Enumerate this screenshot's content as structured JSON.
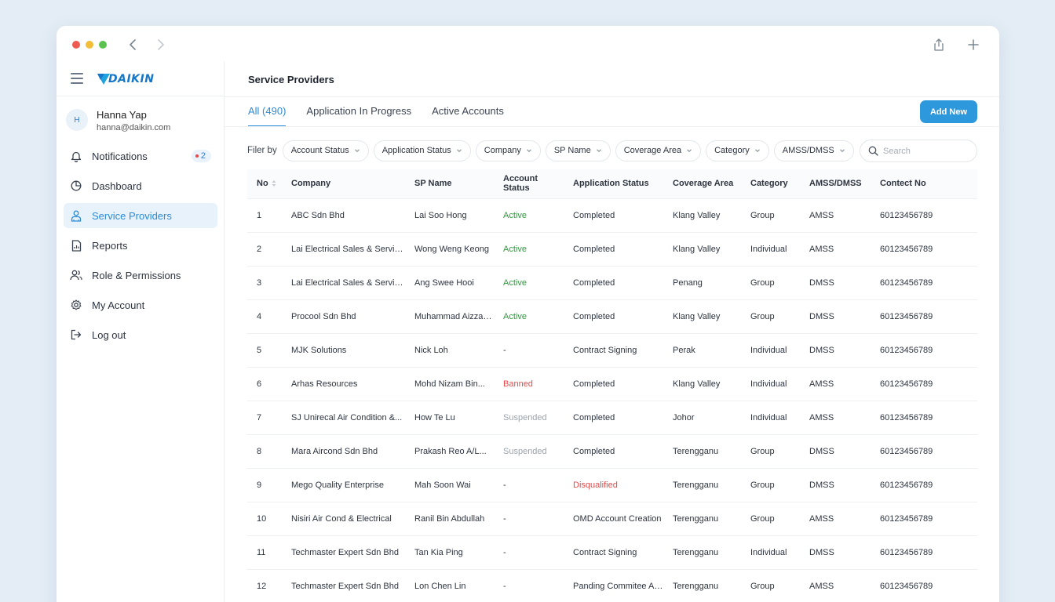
{
  "brand": {
    "name": "DAIKIN",
    "color": "#1677c8"
  },
  "user": {
    "initial": "H",
    "name": "Hanna Yap",
    "email": "hanna@daikin.com"
  },
  "menu": [
    {
      "label": "Notifications",
      "icon": "bell-icon",
      "badge": "2"
    },
    {
      "label": "Dashboard",
      "icon": "dashboard-icon"
    },
    {
      "label": "Service Providers",
      "icon": "service-providers-icon",
      "active": true
    },
    {
      "label": "Reports",
      "icon": "report-icon"
    },
    {
      "label": "Role & Permissions",
      "icon": "users-icon"
    },
    {
      "label": "My Account",
      "icon": "gear-icon"
    },
    {
      "label": "Log out",
      "icon": "logout-icon"
    }
  ],
  "page": {
    "title": "Service Providers",
    "tabs": [
      "All (490)",
      "Application In Progress",
      "Active Accounts"
    ],
    "add_button": "Add New"
  },
  "filters": {
    "label": "Filer by",
    "chips": [
      "Account Status",
      "Application Status",
      "Company",
      "SP Name",
      "Coverage Area",
      "Category",
      "AMSS/DMSS"
    ],
    "search_placeholder": "Search"
  },
  "table": {
    "columns": [
      "No",
      "Company",
      "SP Name",
      "Account Status",
      "Application Status",
      "Coverage Area",
      "Category",
      "AMSS/DMSS",
      "Contect No"
    ],
    "rows": [
      [
        "1",
        "ABC Sdn Bhd",
        "Lai Soo Hong",
        "Active",
        "Completed",
        "Klang Valley",
        "Group",
        "AMSS",
        "60123456789"
      ],
      [
        "2",
        "Lai Electrical Sales & Services",
        "Wong Weng Keong",
        "Active",
        "Completed",
        "Klang Valley",
        "Individual",
        "AMSS",
        "60123456789"
      ],
      [
        "3",
        "Lai Electrical Sales & Services",
        "Ang Swee Hooi",
        "Active",
        "Completed",
        "Penang",
        "Group",
        "DMSS",
        "60123456789"
      ],
      [
        "4",
        "Procool Sdn Bhd",
        "Muhammad Aizzad...",
        "Active",
        "Completed",
        "Klang Valley",
        "Group",
        "DMSS",
        "60123456789"
      ],
      [
        "5",
        "MJK Solutions",
        "Nick Loh",
        "-",
        "Contract Signing",
        "Perak",
        "Individual",
        "DMSS",
        "60123456789"
      ],
      [
        "6",
        "Arhas Resources",
        "Mohd Nizam Bin...",
        "Banned",
        "Completed",
        "Klang Valley",
        "Individual",
        "AMSS",
        "60123456789"
      ],
      [
        "7",
        "SJ Unirecal Air Condition &...",
        "How Te Lu",
        "Suspended",
        "Completed",
        "Johor",
        "Individual",
        "AMSS",
        "60123456789"
      ],
      [
        "8",
        "Mara Aircond Sdn Bhd",
        "Prakash Reo A/L...",
        "Suspended",
        "Completed",
        "Terengganu",
        "Group",
        "DMSS",
        "60123456789"
      ],
      [
        "9",
        "Mego Quality Enterprise",
        "Mah Soon Wai",
        "-",
        "Disqualified",
        "Terengganu",
        "Group",
        "DMSS",
        "60123456789"
      ],
      [
        "10",
        "Nisiri Air Cond & Electrical",
        "Ranil Bin Abdullah",
        "-",
        "OMD Account Creation",
        "Terengganu",
        "Group",
        "AMSS",
        "60123456789"
      ],
      [
        "11",
        "Techmaster Expert Sdn Bhd",
        "Tan Kia Ping",
        "-",
        "Contract Signing",
        "Terengganu",
        "Individual",
        "DMSS",
        "60123456789"
      ],
      [
        "12",
        "Techmaster Expert Sdn Bhd",
        "Lon Chen Lin",
        "-",
        "Panding Commitee Ap...",
        "Terengganu",
        "Group",
        "AMSS",
        "60123456789"
      ]
    ]
  },
  "colors": {
    "accent": "#2e8bd6",
    "active": "#2d9b3c",
    "banned": "#e54848",
    "suspended": "#9aa3ae"
  }
}
